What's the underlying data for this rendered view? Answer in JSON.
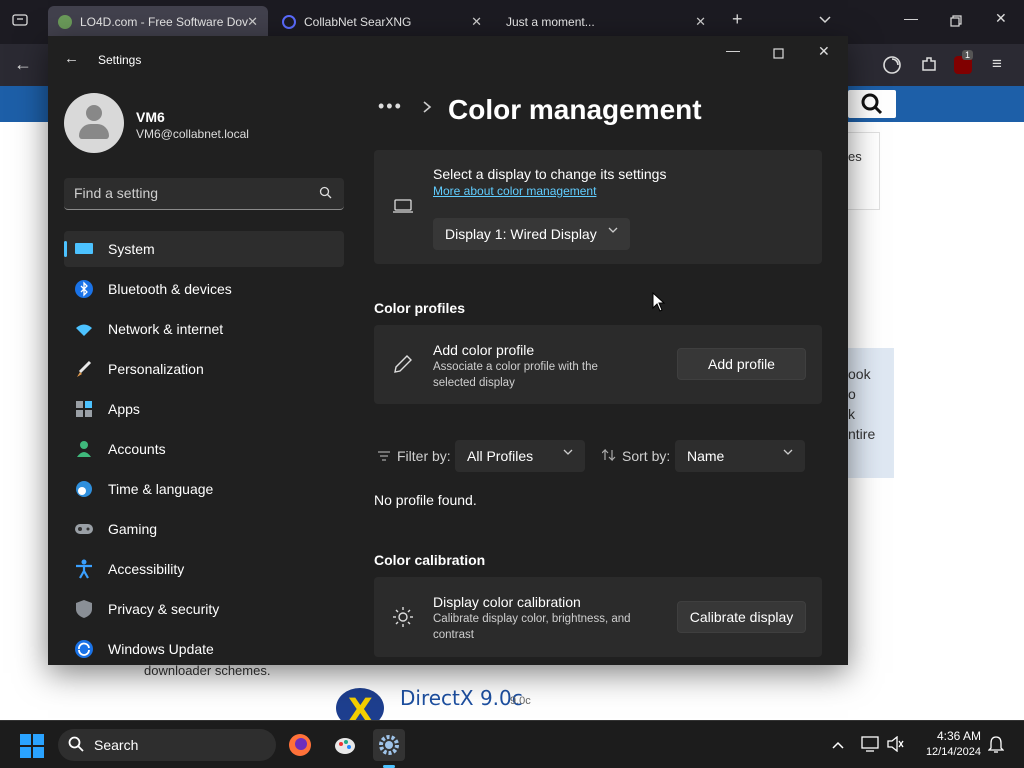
{
  "browser": {
    "tabs": [
      {
        "label": "LO4D.com - Free Software Dov",
        "active": true
      },
      {
        "label": "CollabNet SearXNG",
        "active": false
      },
      {
        "label": "Just a moment...",
        "active": false
      }
    ],
    "extension_badge": "1"
  },
  "website": {
    "side_text": [
      "es",
      "ook",
      "o",
      "k",
      "ntire"
    ],
    "body_snippet": "downloader schemes.",
    "product_title": "DirectX 9.0c",
    "product_version": "9.0c"
  },
  "settings": {
    "window_title": "Settings",
    "user": {
      "name": "VM6",
      "email": "VM6@collabnet.local"
    },
    "search_placeholder": "Find a setting",
    "nav": [
      {
        "label": "System",
        "icon": "system-icon",
        "selected": true
      },
      {
        "label": "Bluetooth & devices",
        "icon": "bluetooth-icon"
      },
      {
        "label": "Network & internet",
        "icon": "wifi-icon"
      },
      {
        "label": "Personalization",
        "icon": "brush-icon"
      },
      {
        "label": "Apps",
        "icon": "apps-icon"
      },
      {
        "label": "Accounts",
        "icon": "person-icon"
      },
      {
        "label": "Time & language",
        "icon": "globe-clock-icon"
      },
      {
        "label": "Gaming",
        "icon": "gamepad-icon"
      },
      {
        "label": "Accessibility",
        "icon": "accessibility-icon"
      },
      {
        "label": "Privacy & security",
        "icon": "shield-icon"
      },
      {
        "label": "Windows Update",
        "icon": "update-icon"
      }
    ],
    "breadcrumb_dots": "•••",
    "page_title": "Color management",
    "display_card": {
      "title": "Select a display to change its settings",
      "link": "More about color management",
      "selected_display": "Display 1: Wired Display"
    },
    "profiles_section": {
      "heading": "Color profiles",
      "add_title": "Add color profile",
      "add_subtitle": "Associate a color profile with the selected display",
      "add_button": "Add profile",
      "filter_label": "Filter by:",
      "filter_value": "All Profiles",
      "sort_label": "Sort by:",
      "sort_value": "Name",
      "empty_text": "No profile found."
    },
    "calibration_section": {
      "heading": "Color calibration",
      "title": "Display color calibration",
      "subtitle": "Calibrate display color, brightness, and contrast",
      "button": "Calibrate display"
    }
  },
  "taskbar": {
    "search_label": "Search",
    "time": "4:36 AM",
    "date": "12/14/2024"
  },
  "colors": {
    "accent": "#4cc2ff",
    "link": "#60cdff",
    "window_bg": "#202020",
    "card_bg": "#2b2b2b"
  }
}
